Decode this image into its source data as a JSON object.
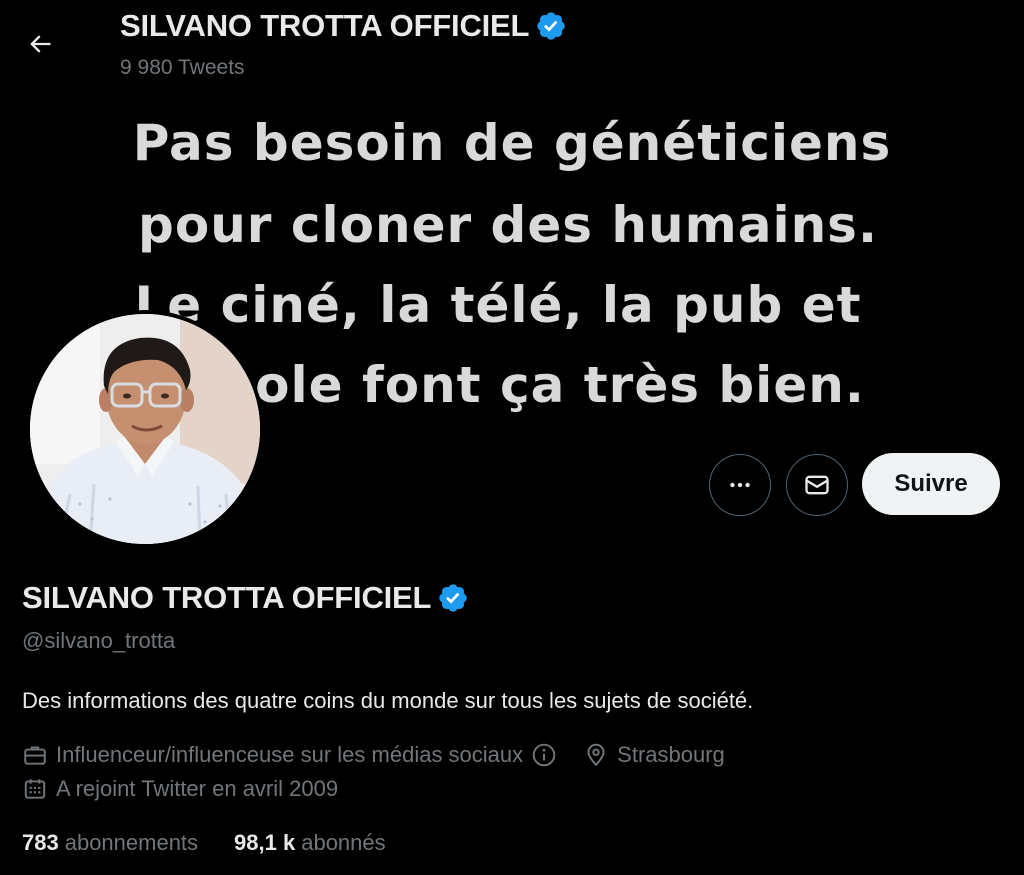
{
  "header": {
    "title": "SILVANO TROTTA OFFICIEL",
    "tweet_count": "9 980 Tweets"
  },
  "banner": {
    "lines": [
      "Pas besoin de généticiens",
      "pour cloner des humains.",
      "Le ciné, la télé, la pub et",
      "l'école font ça très bien."
    ]
  },
  "actions": {
    "follow_label": "Suivre",
    "more_icon": "more-horizontal-icon",
    "message_icon": "envelope-icon"
  },
  "profile": {
    "name": "SILVANO TROTTA OFFICIEL",
    "handle": "@silvano_trotta",
    "bio": "Des informations des quatre coins du monde sur tous les sujets de société.",
    "category": "Influenceur/influenceuse sur les médias sociaux",
    "location": "Strasbourg",
    "joined": "A rejoint Twitter en avril 2009"
  },
  "stats": {
    "following_count": "783",
    "following_label": "abonnements",
    "followers_count": "98,1 k",
    "followers_label": "abonnés"
  },
  "colors": {
    "background": "#000000",
    "text_primary": "#e7e9ea",
    "text_secondary": "#71767b",
    "verified_badge": "#1d9bf0",
    "follow_button_bg": "#eff3f4"
  }
}
